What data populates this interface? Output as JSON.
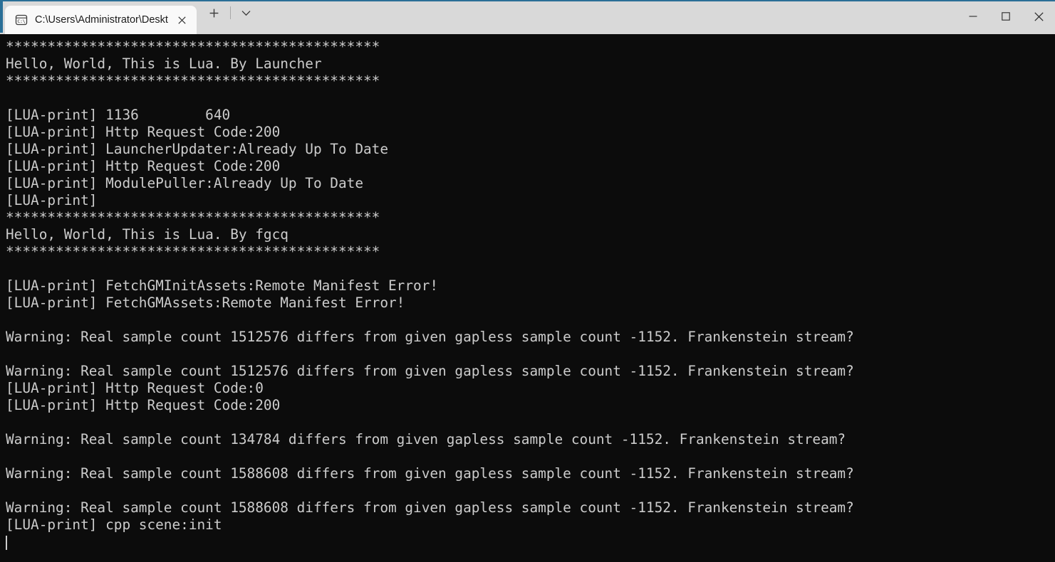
{
  "window": {
    "accent_color": "#2a6f97",
    "titlebar_bg": "#d9d9d9",
    "terminal_bg": "#0c0c0c",
    "terminal_fg": "#cccccc"
  },
  "titlebar": {
    "tabs": [
      {
        "title": "C:\\Users\\Administrator\\Deskt",
        "icon": "console-cmd-icon",
        "icon_label": "C:\\",
        "close_label": "Close tab",
        "active": true
      }
    ],
    "new_tab_label": "+",
    "dropdown_label": "v"
  },
  "window_controls": {
    "minimize_label": "Minimize",
    "maximize_label": "Maximize",
    "close_label": "Close"
  },
  "terminal": {
    "cursor_visible": true,
    "lines": [
      "*********************************************",
      "Hello, World, This is Lua. By Launcher",
      "*********************************************",
      "",
      "[LUA-print] 1136        640",
      "[LUA-print] Http Request Code:200",
      "[LUA-print] LauncherUpdater:Already Up To Date",
      "[LUA-print] Http Request Code:200",
      "[LUA-print] ModulePuller:Already Up To Date",
      "[LUA-print] ",
      "*********************************************",
      "Hello, World, This is Lua. By fgcq",
      "*********************************************",
      "",
      "[LUA-print] FetchGMInitAssets:Remote Manifest Error!",
      "[LUA-print] FetchGMAssets:Remote Manifest Error!",
      "",
      "Warning: Real sample count 1512576 differs from given gapless sample count -1152. Frankenstein stream?",
      "",
      "Warning: Real sample count 1512576 differs from given gapless sample count -1152. Frankenstein stream?",
      "[LUA-print] Http Request Code:0",
      "[LUA-print] Http Request Code:200",
      "",
      "Warning: Real sample count 134784 differs from given gapless sample count -1152. Frankenstein stream?",
      "",
      "Warning: Real sample count 1588608 differs from given gapless sample count -1152. Frankenstein stream?",
      "",
      "Warning: Real sample count 1588608 differs from given gapless sample count -1152. Frankenstein stream?",
      "[LUA-print] cpp scene:init"
    ]
  }
}
